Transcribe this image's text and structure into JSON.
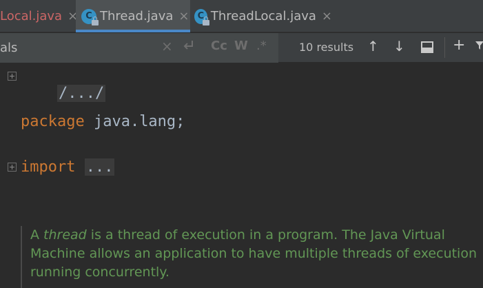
{
  "tabs": [
    {
      "label": "Local.java",
      "close": "×"
    },
    {
      "label": "Thread.java",
      "icon_letter": "C",
      "close": "×"
    },
    {
      "label": "ThreadLocal.java",
      "icon_letter": "C",
      "close": "×"
    }
  ],
  "search": {
    "query": "als",
    "clear_glyph": "×",
    "match_case": "Cc",
    "words": "W",
    "regex": ".*",
    "results": "10 results",
    "up_glyph": "↑",
    "down_glyph": "↓",
    "add_glyph": "+"
  },
  "code": {
    "header_fold": "/.../",
    "package_kw": "package",
    "package_name": " java.lang;",
    "import_kw": "import",
    "import_fold": "..."
  },
  "doc": {
    "prefix": "A ",
    "italic": "thread",
    "line1_rest": " is a thread of execution in a program. The Java Virtual",
    "line2": "Machine allows an application to have multiple threads of execution",
    "line3": "running concurrently."
  },
  "colors": {
    "tab_bar": "#3c3f41",
    "active_tab": "#4e5254",
    "active_underline": "#4a88c7",
    "keyword": "#cc7832",
    "identifier": "#a9b7c6",
    "doc_comment": "#629755",
    "editor_bg": "#2b2b2b",
    "modified_tab_text": "#cc6666"
  }
}
